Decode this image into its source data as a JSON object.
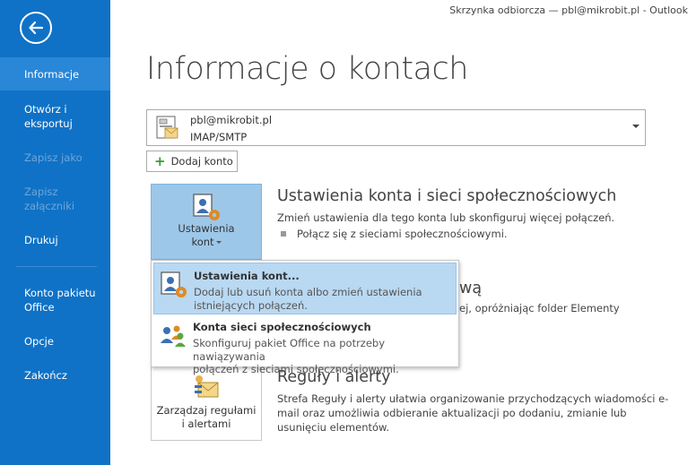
{
  "window": {
    "title": "Skrzynka odbiorcza — pbl@mikrobit.pl - Outlook"
  },
  "sidebar": {
    "items": [
      {
        "label": "Informacje"
      },
      {
        "label": "Otwórz i eksportuj"
      },
      {
        "label": "Zapisz jako"
      },
      {
        "label": "Zapisz załączniki"
      },
      {
        "label": "Drukuj"
      },
      {
        "label": "Konto pakietu Office"
      },
      {
        "label": "Opcje"
      },
      {
        "label": "Zakończ"
      }
    ]
  },
  "page": {
    "title": "Informacje o kontach"
  },
  "account": {
    "email": "pbl@mikrobit.pl",
    "type": "IMAP/SMTP"
  },
  "add_account": {
    "label": "Dodaj konto"
  },
  "tiles": {
    "account_settings": {
      "line1": "Ustawienia",
      "line2": "kont"
    },
    "rules": {
      "line1": "Zarządzaj regułami",
      "line2": "i alertami"
    }
  },
  "sections": {
    "account_settings": {
      "title": "Ustawienia konta i sieci społecznościowych",
      "desc": "Zmień ustawienia dla tego konta lub skonfiguruj więcej połączeń.",
      "bullet": "Połącz się z sieciami społecznościowymi."
    },
    "cleanup": {
      "title_fragment": "wą",
      "desc_fragment": "ej, opróżniając folder Elementy"
    },
    "rules": {
      "title": "Reguły i alerty",
      "desc1": "Strefa Reguły i alerty ułatwia organizowanie przychodzących wiadomości e-",
      "desc2": "mail oraz umożliwia odbieranie aktualizacji po dodaniu, zmianie lub",
      "desc3": "usunięciu elementów."
    }
  },
  "menu": {
    "items": [
      {
        "title": "Ustawienia kont...",
        "desc1": "Dodaj lub usuń konta albo zmień ustawienia",
        "desc2": "istniejących połączeń."
      },
      {
        "title": "Konta sieci społecznościowych",
        "desc1": "Skonfiguruj pakiet Office na potrzeby nawiązywania",
        "desc2": "połączeń z sieciami społecznościowymi."
      }
    ]
  },
  "colors": {
    "sidebar": "#0f72c6",
    "active_tile": "#9dc7e8",
    "menu_highlight": "#b9d8f2"
  }
}
